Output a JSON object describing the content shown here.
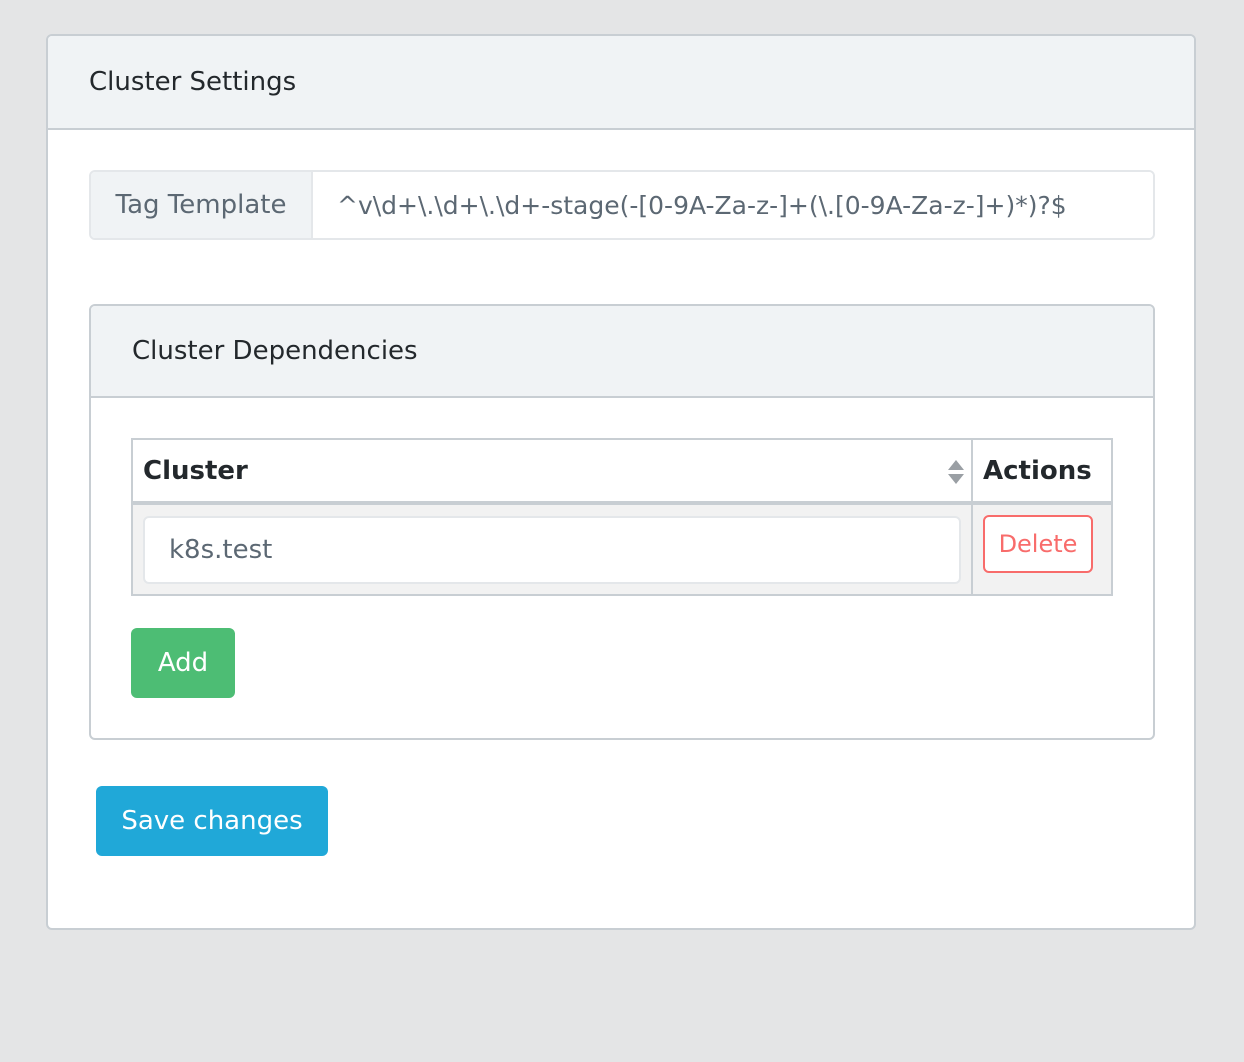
{
  "card": {
    "title": "Cluster Settings"
  },
  "tag_template": {
    "label": "Tag Template",
    "value": "^v\\d+\\.\\d+\\.\\d+-stage(-[0-9A-Za-z-]+(\\.[0-9A-Za-z-]+)*)?$"
  },
  "dependencies": {
    "title": "Cluster Dependencies",
    "table": {
      "columns": [
        "Cluster",
        "Actions"
      ],
      "rows": [
        {
          "cluster": "k8s.test",
          "action": "Delete"
        }
      ]
    },
    "add_label": "Add"
  },
  "save_label": "Save changes",
  "colors": {
    "add": "#4dbd74",
    "save": "#20a8d8",
    "delete": "#f86c6b"
  }
}
